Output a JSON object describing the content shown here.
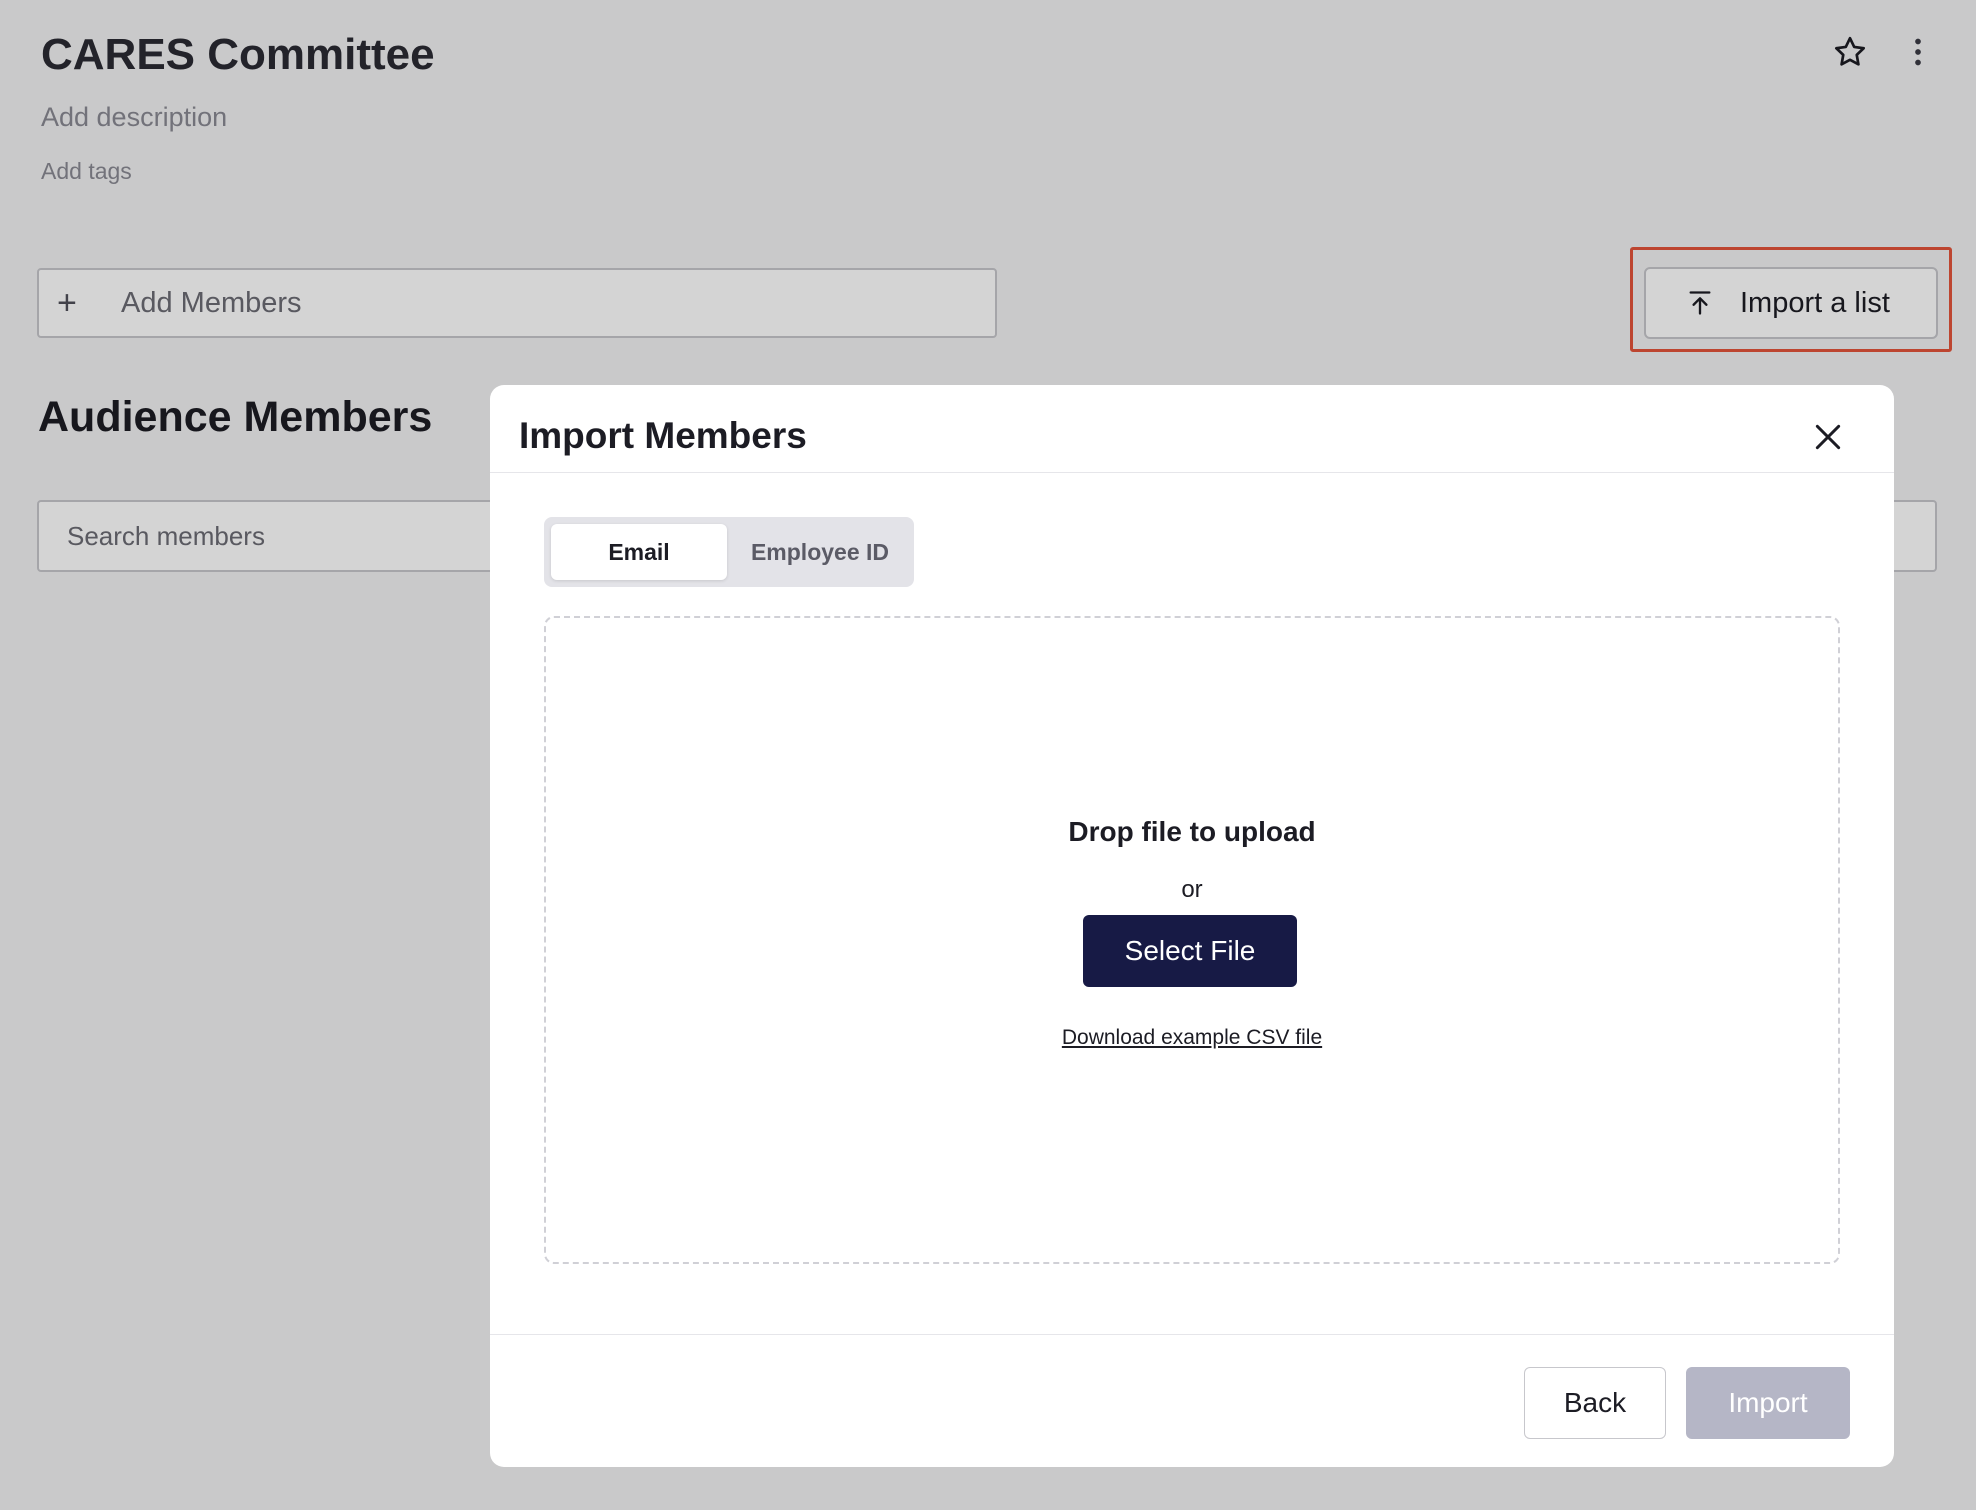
{
  "header": {
    "title": "CARES Committee",
    "description_placeholder": "Add description",
    "tags_placeholder": "Add tags",
    "icons": [
      "star-icon",
      "more-vertical-icon"
    ]
  },
  "toolbar": {
    "add_members_label": "Add Members",
    "import_list_label": "Import a list"
  },
  "section": {
    "title": "Audience Members",
    "search_placeholder": "Search members"
  },
  "modal": {
    "title": "Import Members",
    "tabs": [
      {
        "label": "Email",
        "selected": true
      },
      {
        "label": "Employee ID",
        "selected": false
      }
    ],
    "dropzone": {
      "title": "Drop file to upload",
      "or": "or",
      "select_file_label": "Select File",
      "download_link": "Download example CSV file"
    },
    "footer": {
      "back_label": "Back",
      "import_label": "Import"
    }
  },
  "colors": {
    "primary": "#171a45",
    "disabled": "#b5b6c6",
    "highlight": "#e4533a"
  }
}
